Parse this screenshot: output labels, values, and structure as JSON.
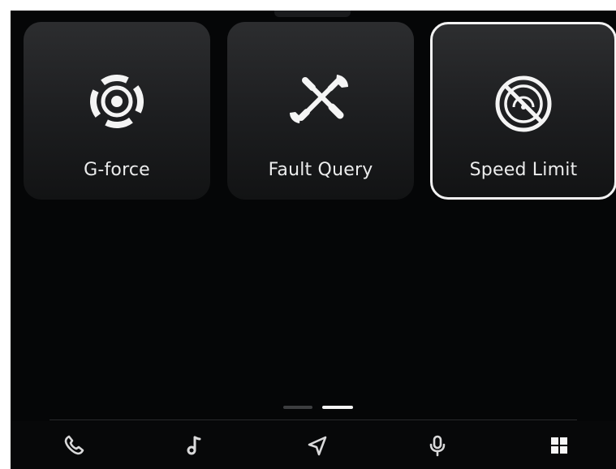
{
  "tiles": [
    {
      "label": "G-force",
      "icon": "target-icon",
      "selected": false
    },
    {
      "label": "Fault Query",
      "icon": "tools-icon",
      "selected": false
    },
    {
      "label": "Speed Limit",
      "icon": "speed-limit-icon",
      "selected": true
    }
  ],
  "pager": {
    "pages": 2,
    "current": 2
  },
  "dock": {
    "items": [
      "phone-icon",
      "music-icon",
      "navigation-icon",
      "microphone-icon",
      "apps-grid-icon"
    ]
  },
  "colors": {
    "background": "#050607",
    "tile": "#232426",
    "selected_border": "#f2f2f2",
    "text": "#eceded",
    "dock_icon": "#d9d9da"
  }
}
